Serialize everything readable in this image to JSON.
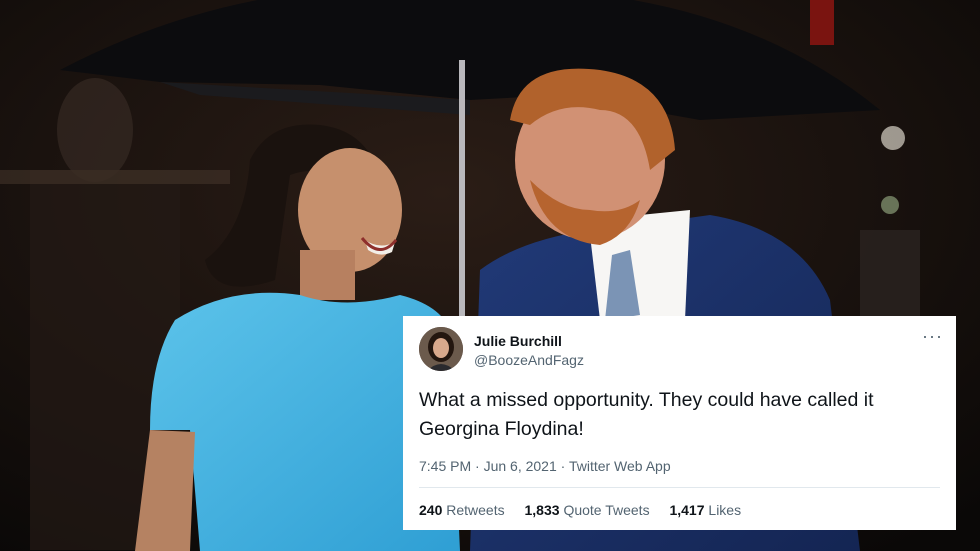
{
  "photo": {
    "icon": "umbrella-couple-photo"
  },
  "tweet": {
    "display_name": "Julie Burchill",
    "handle": "@BoozeAndFagz",
    "text": "What a missed opportunity. They could have called it Georgina Floydina!",
    "timestamp": "7:45 PM · Jun 6, 2021 · Twitter Web App",
    "more_icon": "more-dots-icon",
    "retweets_count": "240",
    "retweets_label": "Retweets",
    "quote_count": "1,833",
    "quote_label": "Quote Tweets",
    "likes_count": "1,417",
    "likes_label": "Likes",
    "colors": {
      "text": "#0f1419",
      "secondary": "#536471",
      "card": "#ffffff"
    }
  }
}
